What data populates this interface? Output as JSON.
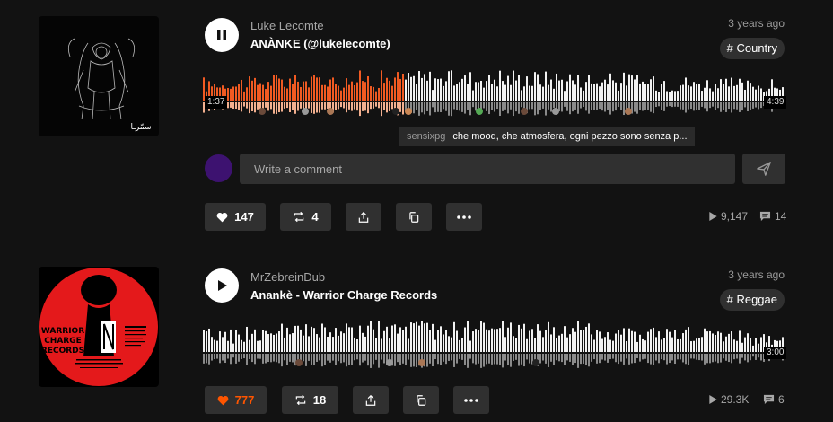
{
  "tracks": [
    {
      "artist": "Luke Lecomte",
      "title": "ANÀNKE (@lukelecomte)",
      "ago": "3 years ago",
      "tag": "# Country",
      "state_icon": "pause-icon",
      "progress": 0.345,
      "time_current": "1:37",
      "time_total": "4:39",
      "tooltip": {
        "user": "sensixpg",
        "text": "che mood, che atmosfera, ogni pezzo sono senza p..."
      },
      "comment": {
        "placeholder": "Write a comment"
      },
      "likes": "147",
      "reposts": "4",
      "plays": "9,147",
      "comments": "14",
      "liked": false
    },
    {
      "artist": "MrZebreinDub",
      "title": "Anankè - Warrior Charge Records",
      "ago": "3 years ago",
      "tag": "# Reggae",
      "state_icon": "play-icon",
      "progress": 0,
      "time_total": "3:00",
      "artwork_text": [
        "WARRIOR",
        "CHARGE",
        "RECORDS"
      ],
      "likes": "777",
      "reposts": "18",
      "plays": "29.3K",
      "comments": "6",
      "liked": true
    }
  ],
  "colors": {
    "accent": "#ff5500",
    "played": "#f15a22",
    "background": "#121212",
    "button": "#303030"
  }
}
